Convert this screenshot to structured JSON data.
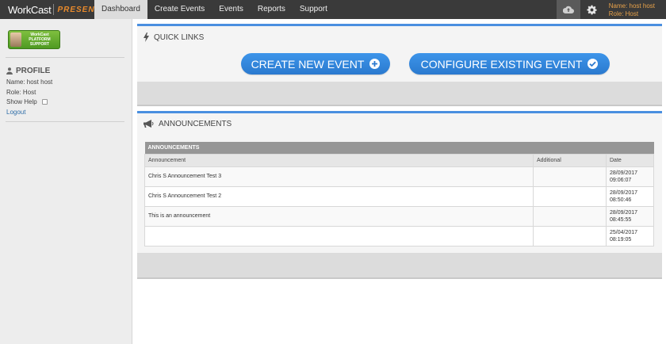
{
  "brand": {
    "name": "WorkCast",
    "sub": "PRESENT+"
  },
  "nav": [
    {
      "label": "Dashboard",
      "active": true
    },
    {
      "label": "Create Events",
      "active": false
    },
    {
      "label": "Events",
      "active": false
    },
    {
      "label": "Reports",
      "active": false
    },
    {
      "label": "Support",
      "active": false
    }
  ],
  "user": {
    "name_line": "Name: host host",
    "role_line": "Role: Host"
  },
  "sidebar": {
    "support_badge": {
      "line1": "WorkCast",
      "line2": "PLATFORM",
      "line3": "SUPPORT"
    },
    "profile": {
      "title": "PROFILE",
      "name": "Name: host host",
      "role": "Role: Host",
      "show_help": "Show Help",
      "logout": "Logout"
    }
  },
  "quick_links": {
    "title": "QUICK LINKS",
    "create_label": "CREATE NEW EVENT",
    "configure_label": "CONFIGURE EXISTING EVENT"
  },
  "announcements": {
    "title": "ANNOUNCEMENTS",
    "table_title": "ANNOUNCEMENTS",
    "columns": [
      "Announcement",
      "Additional",
      "Date"
    ],
    "rows": [
      {
        "announcement": "Chris S Announcement Test 3",
        "additional": "",
        "date": "28/09/2017",
        "time": "09:06:07"
      },
      {
        "announcement": "Chris S Announcement Test 2",
        "additional": "",
        "date": "28/09/2017",
        "time": "08:50:46"
      },
      {
        "announcement": "This is an announcement",
        "additional": "",
        "date": "28/09/2017",
        "time": "08:45:55"
      },
      {
        "announcement": "",
        "additional": "",
        "date": "25/04/2017",
        "time": "08:19:05"
      }
    ]
  },
  "colors": {
    "accent": "#4a8fe0",
    "button": "#3d95ea",
    "topbar": "#3a3a3a",
    "user_text": "#e8a24a"
  },
  "icons": [
    "lightning-icon",
    "plus-circle-icon",
    "check-circle-icon",
    "megaphone-icon",
    "user-icon",
    "cloud-upload-icon",
    "gear-icon"
  ]
}
